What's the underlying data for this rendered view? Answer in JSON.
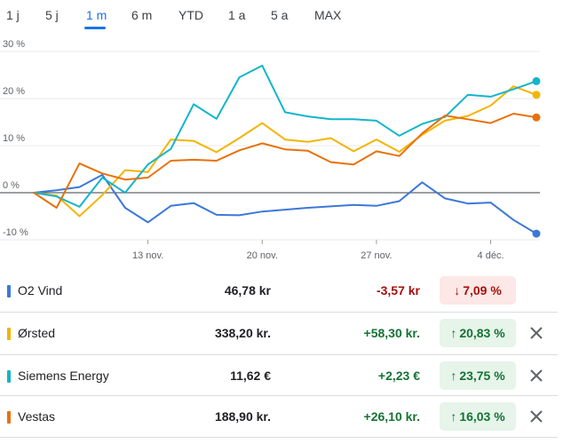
{
  "tabs": [
    {
      "label": "1 j",
      "active": false
    },
    {
      "label": "5 j",
      "active": false
    },
    {
      "label": "1 m",
      "active": true
    },
    {
      "label": "6 m",
      "active": false
    },
    {
      "label": "YTD",
      "active": false
    },
    {
      "label": "1 a",
      "active": false
    },
    {
      "label": "5 a",
      "active": false
    },
    {
      "label": "MAX",
      "active": false
    }
  ],
  "colors": {
    "accent": "#1a73e8",
    "positive": "#137333",
    "positive_bg": "#e6f4ea",
    "negative": "#a50e0e",
    "negative_bg": "#fce8e6"
  },
  "chart_data": {
    "type": "line",
    "y_tick_labels": [
      "30 %",
      "20 %",
      "10 %",
      "0 %",
      "-10 %"
    ],
    "y_ticks": [
      30,
      20,
      10,
      0,
      -10
    ],
    "ylim": [
      -10,
      30
    ],
    "x_tick_labels": [
      "13 nov.",
      "20 nov.",
      "27 nov.",
      "4 déc."
    ],
    "x_ticks": [
      10,
      20,
      30,
      40
    ],
    "xlim": [
      0,
      44
    ],
    "grid": true,
    "series": [
      {
        "name": "O2 Vind",
        "color": "#3c78d8",
        "x": [
          0,
          2,
          4,
          6,
          8,
          10,
          12,
          14,
          16,
          18,
          20,
          22,
          24,
          26,
          28,
          30,
          32,
          34,
          36,
          38,
          40,
          42,
          44
        ],
        "y": [
          0,
          0.5,
          1.2,
          3.8,
          -3.2,
          -6.3,
          -2.8,
          -2.2,
          -4.7,
          -4.8,
          -4.0,
          -3.6,
          -3.2,
          -2.9,
          -2.6,
          -2.8,
          -1.8,
          2.2,
          -1.2,
          -2.3,
          -2.1,
          -5.8,
          -8.7
        ]
      },
      {
        "name": "Ørsted",
        "color": "#f4b400",
        "x": [
          0,
          2,
          4,
          6,
          8,
          10,
          12,
          14,
          16,
          18,
          20,
          22,
          24,
          26,
          28,
          30,
          32,
          34,
          36,
          38,
          40,
          42,
          44
        ],
        "y": [
          0,
          -0.6,
          -5.0,
          -0.5,
          4.8,
          4.4,
          11.3,
          11.0,
          8.6,
          11.6,
          14.8,
          11.3,
          10.8,
          11.6,
          8.8,
          11.3,
          8.7,
          12.3,
          15.3,
          16.3,
          18.5,
          22.6,
          20.8
        ]
      },
      {
        "name": "Siemens Energy",
        "color": "#12b5cb",
        "x": [
          0,
          2,
          4,
          6,
          8,
          10,
          12,
          14,
          16,
          18,
          20,
          22,
          24,
          26,
          28,
          30,
          32,
          34,
          36,
          38,
          40,
          42,
          44
        ],
        "y": [
          0,
          -0.8,
          -3.0,
          3.2,
          0.0,
          6.0,
          9.3,
          18.8,
          15.7,
          24.5,
          27.0,
          17.1,
          16.2,
          15.6,
          15.6,
          15.3,
          12.1,
          14.6,
          16.1,
          20.8,
          20.4,
          22.0,
          23.7
        ]
      },
      {
        "name": "Vestas",
        "color": "#e8710a",
        "x": [
          0,
          2,
          4,
          6,
          8,
          10,
          12,
          14,
          16,
          18,
          20,
          22,
          24,
          26,
          28,
          30,
          32,
          34,
          36,
          38,
          40,
          42,
          44
        ],
        "y": [
          0,
          -3.2,
          6.2,
          4.1,
          2.8,
          3.2,
          6.8,
          7.0,
          6.8,
          9.0,
          10.5,
          9.2,
          8.9,
          6.5,
          6.0,
          8.8,
          7.8,
          12.6,
          16.4,
          15.6,
          14.8,
          16.8,
          16.0
        ]
      }
    ]
  },
  "watchlist": [
    {
      "name": "O2 Vind",
      "color": "#3c78d8",
      "price": "46,78 kr",
      "change": "-3,57 kr",
      "percent": "7,09 %",
      "direction": "down",
      "removable": false
    },
    {
      "name": "Ørsted",
      "color": "#f4b400",
      "price": "338,20 kr.",
      "change": "+58,30 kr.",
      "percent": "20,83 %",
      "direction": "up",
      "removable": true
    },
    {
      "name": "Siemens Energy",
      "color": "#12b5cb",
      "price": "11,62 €",
      "change": "+2,23 €",
      "percent": "23,75 %",
      "direction": "up",
      "removable": true
    },
    {
      "name": "Vestas",
      "color": "#e8710a",
      "price": "188,90 kr.",
      "change": "+26,10 kr.",
      "percent": "16,03 %",
      "direction": "up",
      "removable": true
    }
  ],
  "icons": {
    "up": "arrow-up-icon",
    "down": "arrow-down-icon",
    "close": "close-icon"
  }
}
